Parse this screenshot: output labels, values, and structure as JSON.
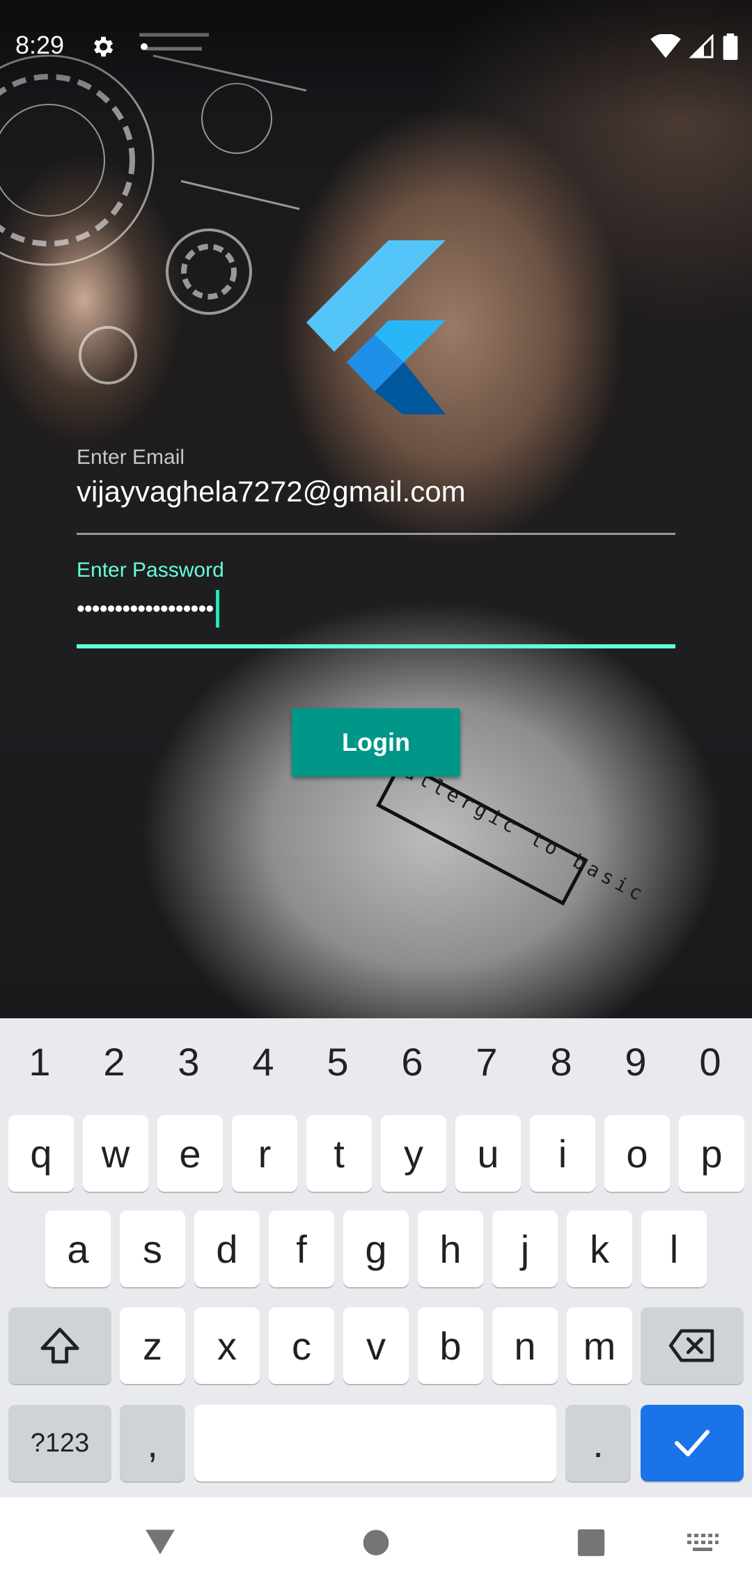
{
  "status_bar": {
    "time": "8:29",
    "icons": [
      "gear-icon",
      "notification-dot-icon",
      "wifi-icon",
      "signal-icon",
      "battery-icon"
    ]
  },
  "background": {
    "graphic_text": "allergic to basic"
  },
  "logo": {
    "icon": "flutter-logo-icon",
    "colors": [
      "#54C5F8",
      "#29B6F6",
      "#01579B"
    ]
  },
  "form": {
    "email": {
      "label": "Enter Email",
      "value": "vijayvaghela7272@gmail.com"
    },
    "password": {
      "label": "Enter Password",
      "masked_value": "••••••••••••••••••",
      "focused": true
    },
    "login_button": "Login"
  },
  "colors": {
    "accent": "#64FFDA",
    "button": "#009688",
    "keyboard_bg": "#E8EAED",
    "done_key": "#1A73E8"
  },
  "keyboard": {
    "number_row": [
      "1",
      "2",
      "3",
      "4",
      "5",
      "6",
      "7",
      "8",
      "9",
      "0"
    ],
    "row1": [
      "q",
      "w",
      "e",
      "r",
      "t",
      "y",
      "u",
      "i",
      "o",
      "p"
    ],
    "row2": [
      "a",
      "s",
      "d",
      "f",
      "g",
      "h",
      "j",
      "k",
      "l"
    ],
    "row3": [
      "z",
      "x",
      "c",
      "v",
      "b",
      "n",
      "m"
    ],
    "symbols_key": "?123",
    "comma_key": ",",
    "period_key": ".",
    "shift_icon": "shift-icon",
    "backspace_icon": "backspace-icon",
    "done_icon": "checkmark-icon"
  },
  "nav_bar": {
    "icons": [
      "back-icon",
      "home-icon",
      "recents-icon",
      "keyboard-icon"
    ]
  }
}
